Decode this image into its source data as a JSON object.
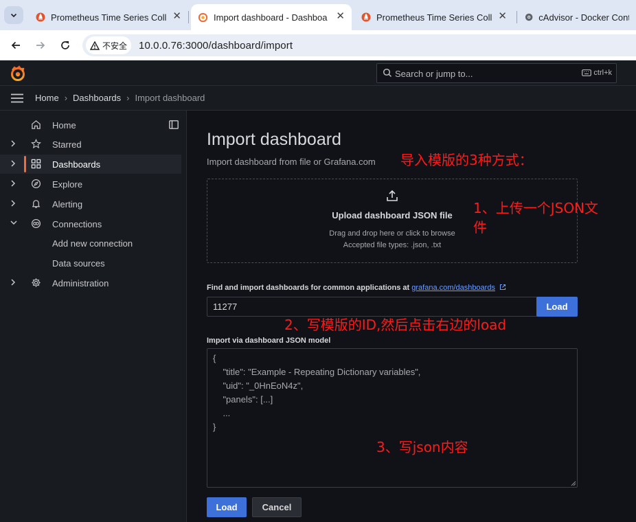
{
  "browser": {
    "tabs": [
      {
        "title": "Prometheus Time Series Colle",
        "icon": "prometheus-icon",
        "active": false
      },
      {
        "title": "Import dashboard - Dashboa",
        "icon": "grafana-icon",
        "active": true
      },
      {
        "title": "Prometheus Time Series Colle",
        "icon": "prometheus-icon",
        "active": false
      },
      {
        "title": "cAdvisor - Docker Conta",
        "icon": "globe-icon",
        "active": false
      }
    ],
    "close_glyph": "✕",
    "security_label": "不安全",
    "url": "10.0.0.76:3000/dashboard/import"
  },
  "topbar": {
    "search_placeholder": "Search or jump to...",
    "shortcut": "ctrl+k"
  },
  "breadcrumb": {
    "items": [
      "Home",
      "Dashboards"
    ],
    "current": "Import dashboard",
    "separator": "›"
  },
  "sidebar": {
    "items": [
      {
        "label": "Home",
        "icon": "home-icon",
        "expandable": false,
        "active": false
      },
      {
        "label": "Starred",
        "icon": "star-icon",
        "expandable": true,
        "active": false
      },
      {
        "label": "Dashboards",
        "icon": "apps-icon",
        "expandable": true,
        "active": true
      },
      {
        "label": "Explore",
        "icon": "compass-icon",
        "expandable": true,
        "active": false
      },
      {
        "label": "Alerting",
        "icon": "bell-icon",
        "expandable": true,
        "active": false
      },
      {
        "label": "Connections",
        "icon": "connections-icon",
        "expandable": true,
        "expanded": true,
        "active": false
      },
      {
        "label": "Add new connection",
        "sub": true
      },
      {
        "label": "Data sources",
        "sub": true
      },
      {
        "label": "Administration",
        "icon": "cog-icon",
        "expandable": true,
        "active": false
      }
    ]
  },
  "main": {
    "title": "Import dashboard",
    "subtitle": "Import dashboard from file or Grafana.com",
    "upload": {
      "title": "Upload dashboard JSON file",
      "hint": "Drag and drop here or click to browse",
      "types": "Accepted file types: .json, .txt"
    },
    "gcom": {
      "label": "Find and import dashboards for common applications at",
      "link": "grafana.com/dashboards",
      "value": "11277",
      "load_label": "Load"
    },
    "json_model": {
      "label": "Import via dashboard JSON model",
      "lines": [
        "{",
        "    \"title\": \"Example - Repeating Dictionary variables\",",
        "    \"uid\": \"_0HnEoN4z\",",
        "    \"panels\": [...]",
        "    ...",
        "}"
      ]
    },
    "load_label": "Load",
    "cancel_label": "Cancel"
  },
  "annotations": {
    "heading": "导入模版的3种方式：",
    "step1_line1": "1、上传一个JSON文",
    "step1_line2": "件",
    "step2": "2、写模版的ID,然后点击右边的load",
    "step3": "3、写json内容"
  },
  "colors": {
    "accent": "#f46b3b",
    "primary_button": "#3d71d9",
    "annotation": "#ff1a1a",
    "link": "#6e9fff"
  }
}
